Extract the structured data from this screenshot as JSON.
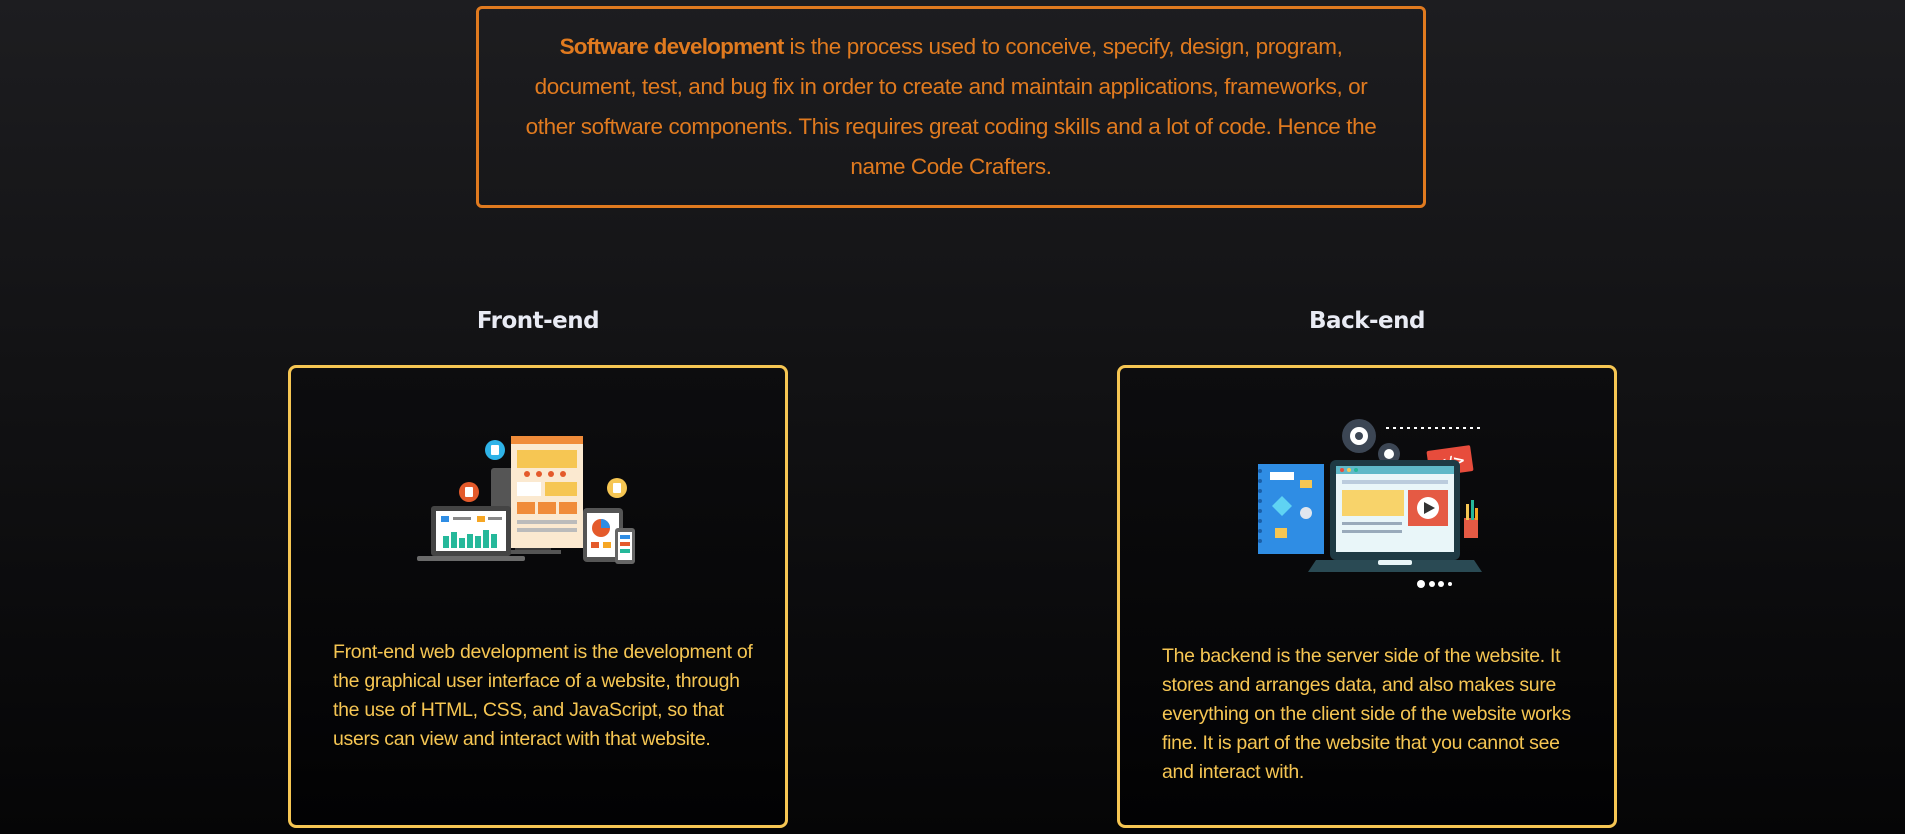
{
  "intro": {
    "strong": "Software development",
    "text": " is the process used to conceive, specify, design, program, document, test, and bug fix in order to create and maintain applications, frameworks, or other software components. This requires great coding skills and a lot of code. Hence the name Code Crafters."
  },
  "sections": [
    {
      "title": "Front-end",
      "illustration": "devices-responsive-illustration",
      "description": "Front-end web development is the development of the graphical user interface of a website, through the use of HTML, CSS, and JavaScript, so that users can view and interact with that website."
    },
    {
      "title": "Back-end",
      "illustration": "server-code-laptop-illustration",
      "description": "The backend is the server side of the website. It stores and arranges data, and also makes sure everything on the client side of the website works fine. It is part of the website that you cannot see and interact with."
    }
  ],
  "colors": {
    "accent_orange": "#e07a1f",
    "accent_yellow": "#f6c653",
    "heading": "#e9ebf4"
  },
  "illustration_labels": {
    "code_tag": "</>"
  }
}
